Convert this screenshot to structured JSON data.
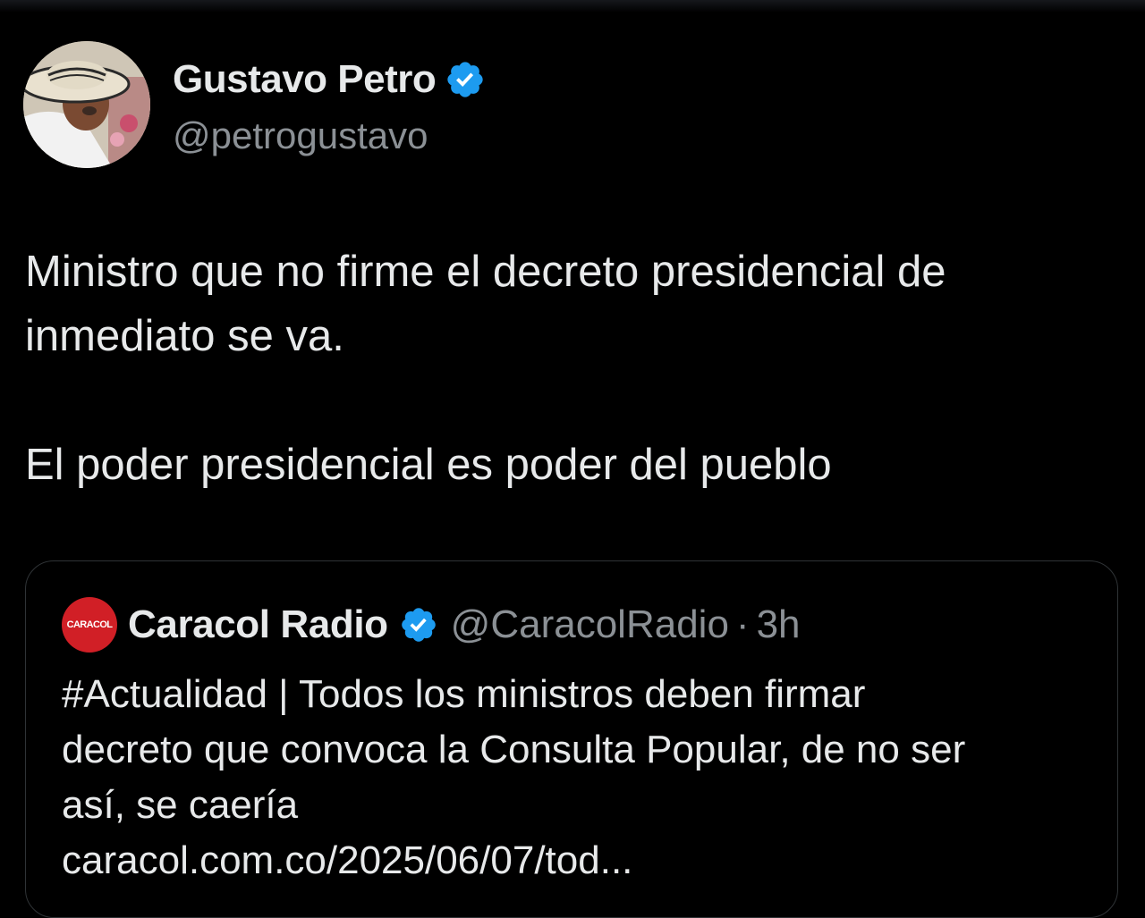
{
  "tweet": {
    "author": {
      "display_name": "Gustavo Petro",
      "handle": "@petrogustavo",
      "verified": true,
      "avatar_icon": "profile-photo"
    },
    "text": "Ministro que no firme el decreto presidencial de\ninmediato se va.\n\nEl poder presidencial es poder del pueblo",
    "quoted": {
      "author": {
        "display_name": "Caracol Radio",
        "handle": "@CaracolRadio",
        "verified": true,
        "avatar_text": "CARACOL"
      },
      "separator": "·",
      "time": "3h",
      "text": "#Actualidad | Todos los ministros deben firmar\ndecreto que convoca la Consulta Popular, de no ser\nasí, se caería",
      "link": "caracol.com.co/2025/06/07/tod..."
    }
  },
  "colors": {
    "background": "#000000",
    "primary_text": "#e7e9ea",
    "secondary_text": "#8b9095",
    "border": "#2f3336",
    "verified_blue": "#1d9bf0",
    "caracol_red": "#d11f26"
  }
}
